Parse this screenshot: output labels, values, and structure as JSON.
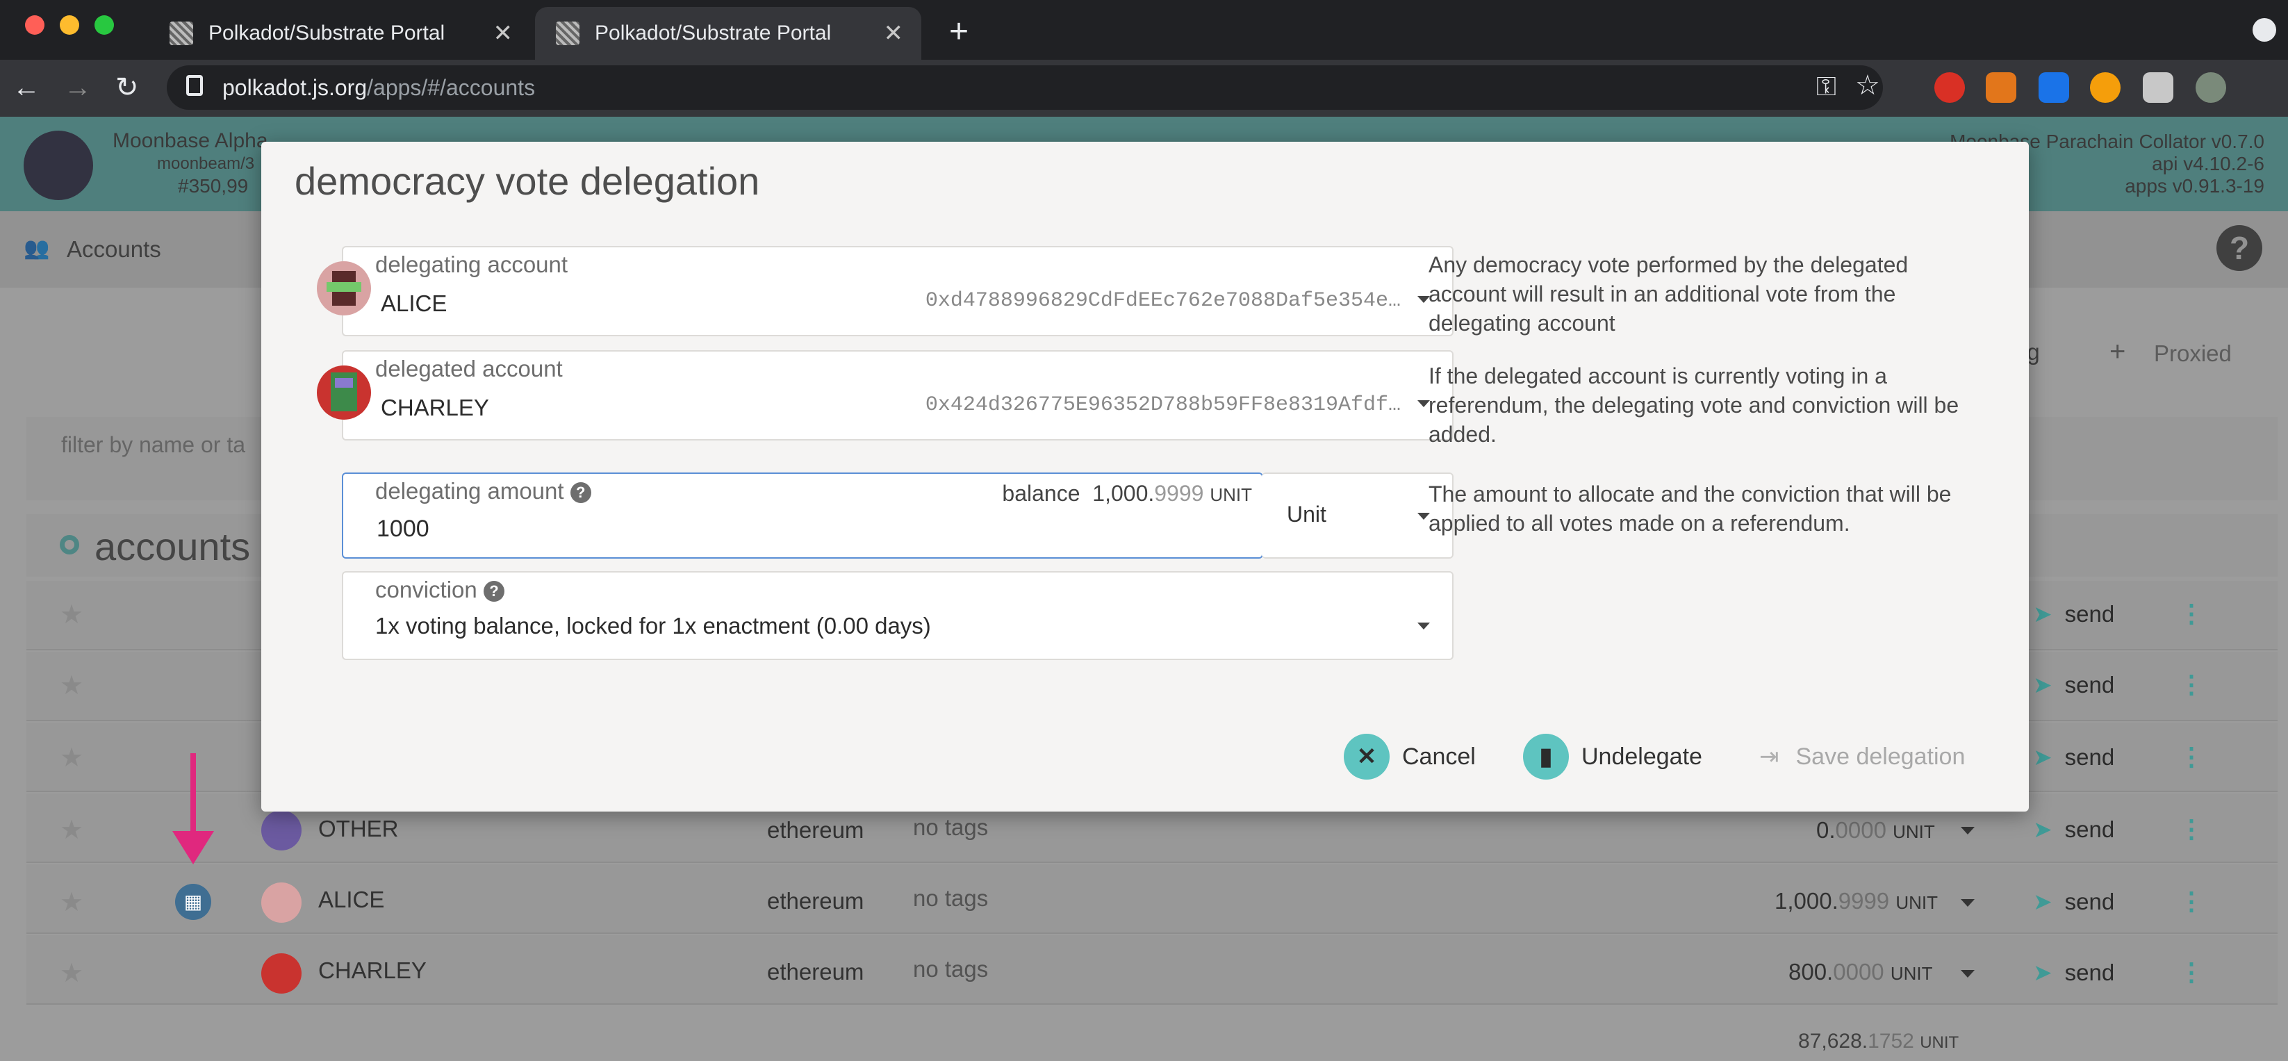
{
  "browser": {
    "tabs": [
      {
        "title": "Polkadot/Substrate Portal",
        "active": false
      },
      {
        "title": "Polkadot/Substrate Portal",
        "active": true
      }
    ],
    "url_host": "polkadot.js.org",
    "url_path": "/apps/#/accounts"
  },
  "app": {
    "chain_name": "Moonbase Alpha",
    "chain_runtime": "moonbeam/3",
    "block_number": "#350,99",
    "version_node": "Moonbase Parachain Collator v0.7.0",
    "version_api": "api v4.10.2-6",
    "version_apps": "apps v0.91.3-19",
    "nav_accounts": "Accounts",
    "toolbar_proxied": "Proxied",
    "toolbar_partial": "ig",
    "filter_placeholder": "filter by name or ta",
    "section_title": "accounts",
    "total_balance_int": "87,628.",
    "total_balance_dec": "1752",
    "unit": "UNIT",
    "send_label": "send",
    "rows": [
      {
        "name": "OTHER",
        "type": "ethereum",
        "tags": "no tags",
        "bal_int": "0.",
        "bal_dec": "0000"
      },
      {
        "name": "ALICE",
        "type": "ethereum",
        "tags": "no tags",
        "bal_int": "1,000.",
        "bal_dec": "9999"
      },
      {
        "name": "CHARLEY",
        "type": "ethereum",
        "tags": "no tags",
        "bal_int": "800.",
        "bal_dec": "0000"
      }
    ]
  },
  "modal": {
    "title": "democracy vote delegation",
    "delegating_account_label": "delegating account",
    "delegating_account_name": "ALICE",
    "delegating_account_address": "0xd4788996829CdFdEEc762e7088Daf5e354e…",
    "delegated_account_label": "delegated account",
    "delegated_account_name": "CHARLEY",
    "delegated_account_address": "0x424d326775E96352D788b59FF8e8319Afdf…",
    "amount_label": "delegating amount",
    "amount_value": "1000",
    "balance_label": "balance",
    "balance_int": "1,000.",
    "balance_dec": "9999",
    "balance_unit": "UNIT",
    "unit_select": "Unit",
    "conviction_label": "conviction",
    "conviction_value": "1x voting balance, locked for 1x enactment (0.00 days)",
    "help_1": "Any democracy vote performed by the delegated account will result in an additional vote from the delegating account",
    "help_2": "If the delegated account is currently voting in a referendum, the delegating vote and conviction will be added.",
    "help_3": "The amount to allocate and the conviction that will be applied to all votes made on a referendum.",
    "cancel_label": "Cancel",
    "undelegate_label": "Undelegate",
    "save_label": "Save delegation"
  },
  "colors": {
    "accent": "#5ec4c0",
    "header_teal": "#5fb7b3",
    "arrow_pink": "#e0287e"
  },
  "icons": [
    "search-icon",
    "star-icon",
    "calendar-icon",
    "send-icon",
    "more-icon",
    "help-icon",
    "cancel-icon",
    "trash-icon",
    "sign-in-icon",
    "accounts-icon",
    "lock-icon",
    "key-icon"
  ]
}
